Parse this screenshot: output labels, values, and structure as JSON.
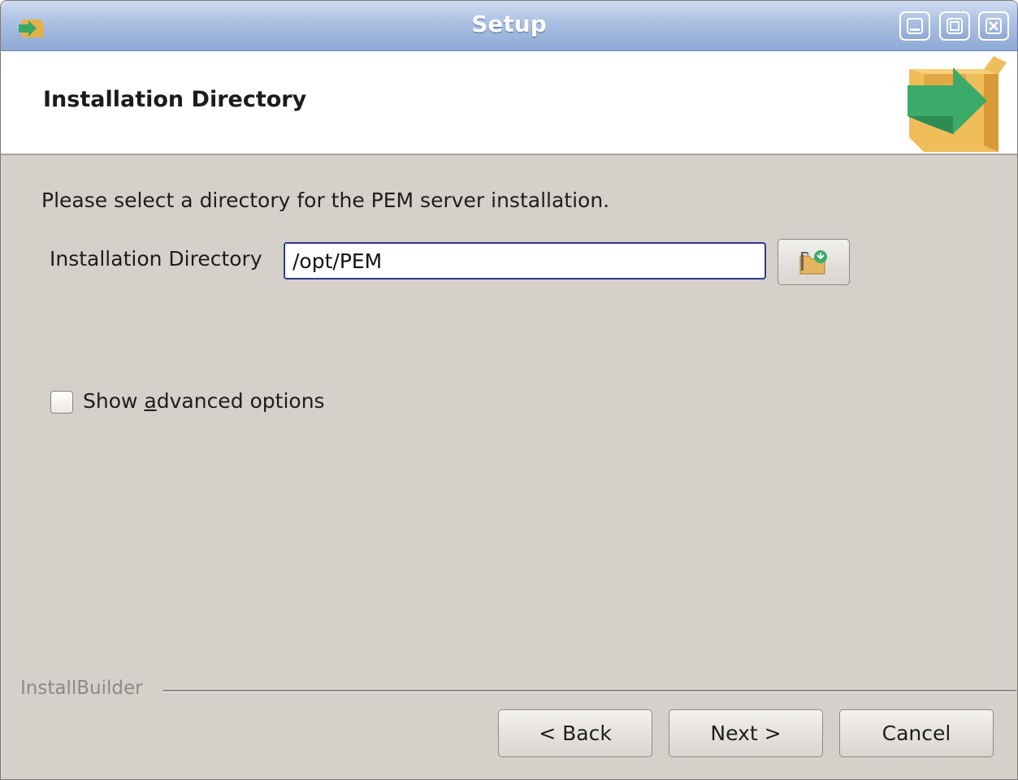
{
  "window": {
    "title": "Setup",
    "controls": [
      "minimize-icon",
      "maximize-icon",
      "close-icon"
    ]
  },
  "header": {
    "title": "Installation Directory",
    "logo_icon": "install-box-arrow-icon"
  },
  "content": {
    "instruction": "Please select a directory for the PEM server installation.",
    "directory_label": "Installation Directory",
    "directory_value": "/opt/PEM",
    "browse_icon": "folder-browse-icon",
    "advanced_checkbox": {
      "label_before": "Show ",
      "label_underlined": "a",
      "label_after": "dvanced options",
      "checked": false
    }
  },
  "footer": {
    "brand": "InstallBuilder",
    "back_label": "< Back",
    "next_label": "Next >",
    "cancel_label": "Cancel"
  },
  "colors": {
    "titlebar": "#aac0e2",
    "dialog_bg": "#d5d1ca",
    "input_border": "#2e3a8f",
    "arrow_green": "#3cab6a",
    "box_tan": "#efbd5a"
  }
}
